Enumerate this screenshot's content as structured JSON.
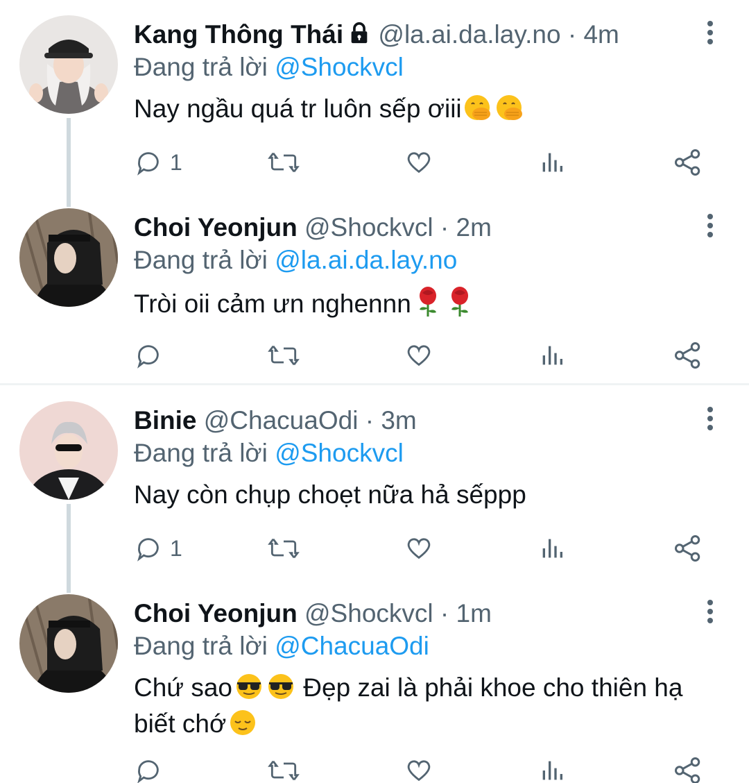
{
  "tweets": [
    {
      "name": "Kang Thông Thái",
      "handle": "@la.ai.da.lay.no",
      "time": "4m",
      "replying_prefix": "Đang trả lời",
      "replying_to": "@Shockvcl",
      "text": "Nay ngầu quá tr luôn sếp ơiii",
      "emojis": [
        "hand-over-mouth-emoji",
        "hand-over-mouth-emoji"
      ],
      "reply_count": "1",
      "locked": true
    },
    {
      "name": "Choi Yeonjun",
      "handle": "@Shockvcl",
      "time": "2m",
      "replying_prefix": "Đang trả lời",
      "replying_to": "@la.ai.da.lay.no",
      "text": "Tròi oii cảm ưn nghennn",
      "emojis": [
        "rose-emoji",
        "rose-emoji"
      ],
      "reply_count": ""
    },
    {
      "name": "Binie",
      "handle": "@ChacuaOdi",
      "time": "3m",
      "replying_prefix": "Đang trả lời",
      "replying_to": "@Shockvcl",
      "text": "Nay còn chụp choẹt nữa hả sếppp",
      "emojis": [],
      "reply_count": "1"
    },
    {
      "name": "Choi Yeonjun",
      "handle": "@Shockvcl",
      "time": "1m",
      "replying_prefix": "Đang trả lời",
      "replying_to": "@ChacuaOdi",
      "text_part1": "Chứ sao",
      "text_part2": "Đẹp zai là phải khoe cho thiên hạ",
      "text_part3": "biết chớ",
      "emojis": [
        "sunglasses-emoji",
        "sunglasses-emoji",
        "relieved-face-emoji"
      ],
      "reply_count": ""
    }
  ],
  "separator": "·",
  "colors": {
    "accent": "#1d9bf0",
    "secondary_text": "#536471",
    "primary_text": "#0f1419",
    "thread_line": "#cfd9de"
  }
}
